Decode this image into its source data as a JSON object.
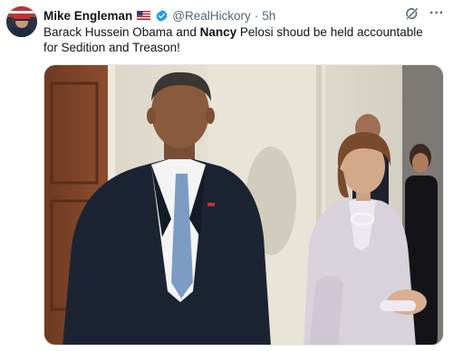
{
  "author": {
    "name": "Mike Engleman",
    "flag_icon": "us-flag-icon",
    "verified_icon": "verified-badge-icon",
    "handle": "@RealHickory",
    "separator": "·",
    "time": "5h"
  },
  "header_actions": {
    "grok_icon": "grok-icon",
    "more_label": "···"
  },
  "tweet": {
    "text_part1": "Barack Hussein Obama and ",
    "text_bold": "Nancy",
    "text_part2": " Pelosi shoud be held accountable for Sedition and Treason!"
  },
  "media": {
    "type": "photo",
    "description_icon": "photo-image"
  },
  "colors": {
    "primary_text": "#0f1419",
    "secondary_text": "#536471",
    "verified_blue": "#1d9bf0"
  }
}
